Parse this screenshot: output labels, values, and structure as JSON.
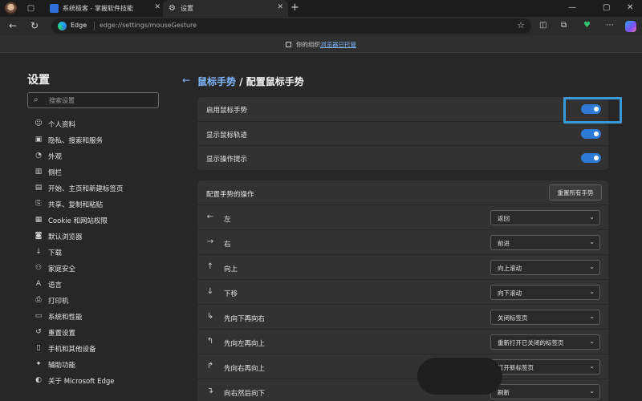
{
  "tabs": [
    {
      "label": "系统极客 - 掌握软件技能",
      "active": false
    },
    {
      "label": "设置",
      "active": true
    }
  ],
  "address": {
    "brand": "Edge",
    "url": "edge://settings/mouseGesture"
  },
  "infobar": {
    "text": "你的组织",
    "link": "浏览器已托管"
  },
  "sidebar": {
    "title": "设置",
    "search_placeholder": "搜索设置",
    "items": [
      {
        "label": "个人资料",
        "icon": "profile-icon"
      },
      {
        "label": "隐私、搜索和服务",
        "icon": "lock-icon"
      },
      {
        "label": "外观",
        "icon": "appearance-icon"
      },
      {
        "label": "侧栏",
        "icon": "sidebar-icon"
      },
      {
        "label": "开始、主页和新建标签页",
        "icon": "home-icon"
      },
      {
        "label": "共享、复制和粘贴",
        "icon": "share-icon"
      },
      {
        "label": "Cookie 和网站权限",
        "icon": "cookie-icon"
      },
      {
        "label": "默认浏览器",
        "icon": "browser-icon"
      },
      {
        "label": "下载",
        "icon": "download-icon"
      },
      {
        "label": "家庭安全",
        "icon": "family-icon"
      },
      {
        "label": "语言",
        "icon": "language-icon"
      },
      {
        "label": "打印机",
        "icon": "printer-icon"
      },
      {
        "label": "系统和性能",
        "icon": "system-icon"
      },
      {
        "label": "重置设置",
        "icon": "reset-icon"
      },
      {
        "label": "手机和其他设备",
        "icon": "phone-icon"
      },
      {
        "label": "辅助功能",
        "icon": "accessibility-icon"
      },
      {
        "label": "关于 Microsoft Edge",
        "icon": "edge-icon"
      }
    ]
  },
  "main": {
    "breadcrumb_parent": "鼠标手势",
    "breadcrumb_current": " / 配置鼠标手势",
    "toggles": [
      {
        "label": "启用鼠标手势",
        "on": true
      },
      {
        "label": "显示鼠标轨迹",
        "on": true
      },
      {
        "label": "显示操作提示",
        "on": true
      }
    ],
    "gestures_header": "配置手势的操作",
    "reset_label": "重置所有手势",
    "gestures": [
      {
        "icon": "←",
        "label": "左",
        "action": "返回"
      },
      {
        "icon": "→",
        "label": "右",
        "action": "前进"
      },
      {
        "icon": "↑",
        "label": "向上",
        "action": "向上滚动"
      },
      {
        "icon": "↓",
        "label": "下移",
        "action": "向下滚动"
      },
      {
        "icon": "↳",
        "label": "先向下再向右",
        "action": "关闭标签页"
      },
      {
        "icon": "↰",
        "label": "先向左再向上",
        "action": "重新打开已关闭的标签页"
      },
      {
        "icon": "↱",
        "label": "先向右再向上",
        "action": "打开新标签页"
      },
      {
        "icon": "↴",
        "label": "向右然后向下",
        "action": "刷新"
      }
    ]
  },
  "colors": {
    "accent": "#2f7ad4",
    "link": "#7fb8ff",
    "highlight": "#3a97d8"
  }
}
